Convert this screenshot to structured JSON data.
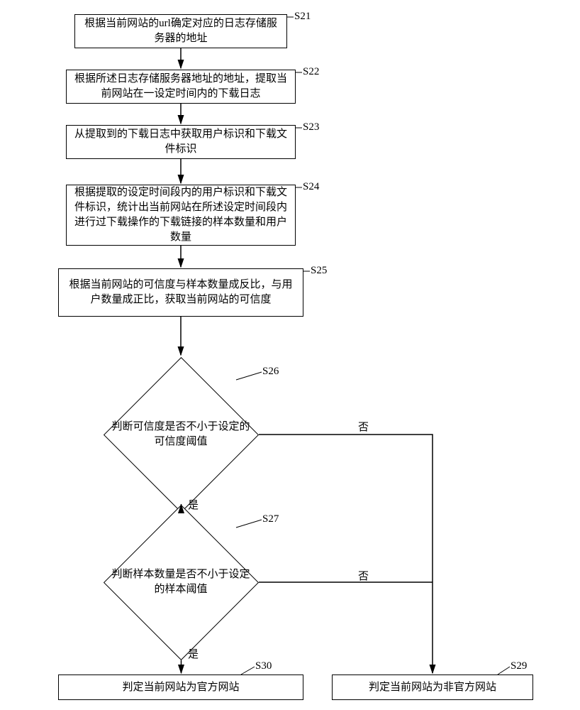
{
  "steps": {
    "s21": {
      "label": "S21",
      "text": "根据当前网站的url确定对应的日志存储服务器的地址"
    },
    "s22": {
      "label": "S22",
      "text": "根据所述日志存储服务器地址的地址，提取当前网站在一设定时间内的下载日志"
    },
    "s23": {
      "label": "S23",
      "text": "从提取到的下载日志中获取用户标识和下载文件标识"
    },
    "s24": {
      "label": "S24",
      "text": "根据提取的设定时间段内的用户标识和下载文件标识，统计出当前网站在所述设定时间段内进行过下载操作的下载链接的样本数量和用户数量"
    },
    "s25": {
      "label": "S25",
      "text": "根据当前网站的可信度与样本数量成反比，与用户数量成正比，获取当前网站的可信度"
    },
    "s26": {
      "label": "S26",
      "text": "判断可信度是否不小于设定的可信度阈值"
    },
    "s27": {
      "label": "S27",
      "text": "判断样本数量是否不小于设定的样本阈值"
    },
    "s29": {
      "label": "S29",
      "text": "判定当前网站为非官方网站"
    },
    "s30": {
      "label": "S30",
      "text": "判定当前网站为官方网站"
    }
  },
  "edges": {
    "yes": "是",
    "no": "否"
  }
}
